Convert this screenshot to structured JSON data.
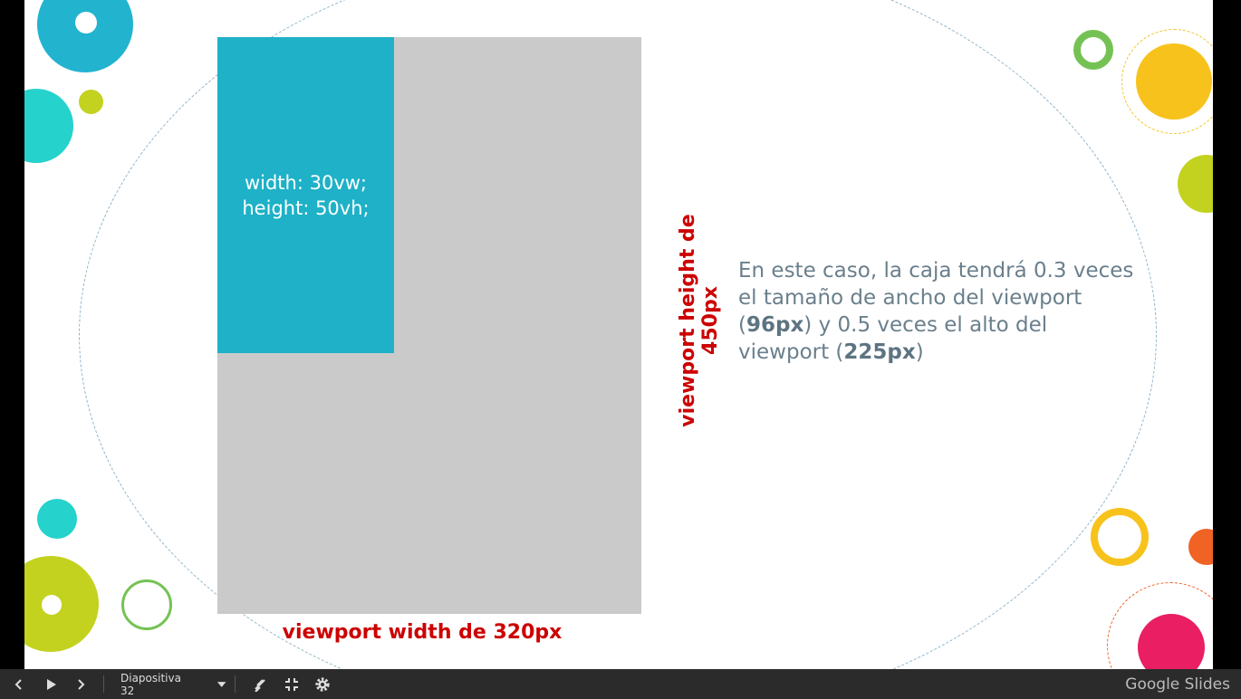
{
  "slide": {
    "box_label_line1": "width: 30vw;",
    "box_label_line2": "height: 50vh;",
    "viewport_width_label": "viewport width de 320px",
    "viewport_height_label": "viewport height de 450px",
    "explanation": {
      "part1": "En este caso, la caja tendrá 0.3 veces el tamaño de ancho del viewport (",
      "bold1": "96px",
      "part2": ") y 0.5 veces el alto del viewport (",
      "bold2": "225px",
      "part3": ")"
    }
  },
  "toolbar": {
    "slide_selector": "Diapositiva 32",
    "brand": "Google Slides"
  },
  "colors": {
    "accent_teal": "#1eb1c7",
    "label_red": "#cc0000",
    "viewport_gray": "#cacaca"
  }
}
